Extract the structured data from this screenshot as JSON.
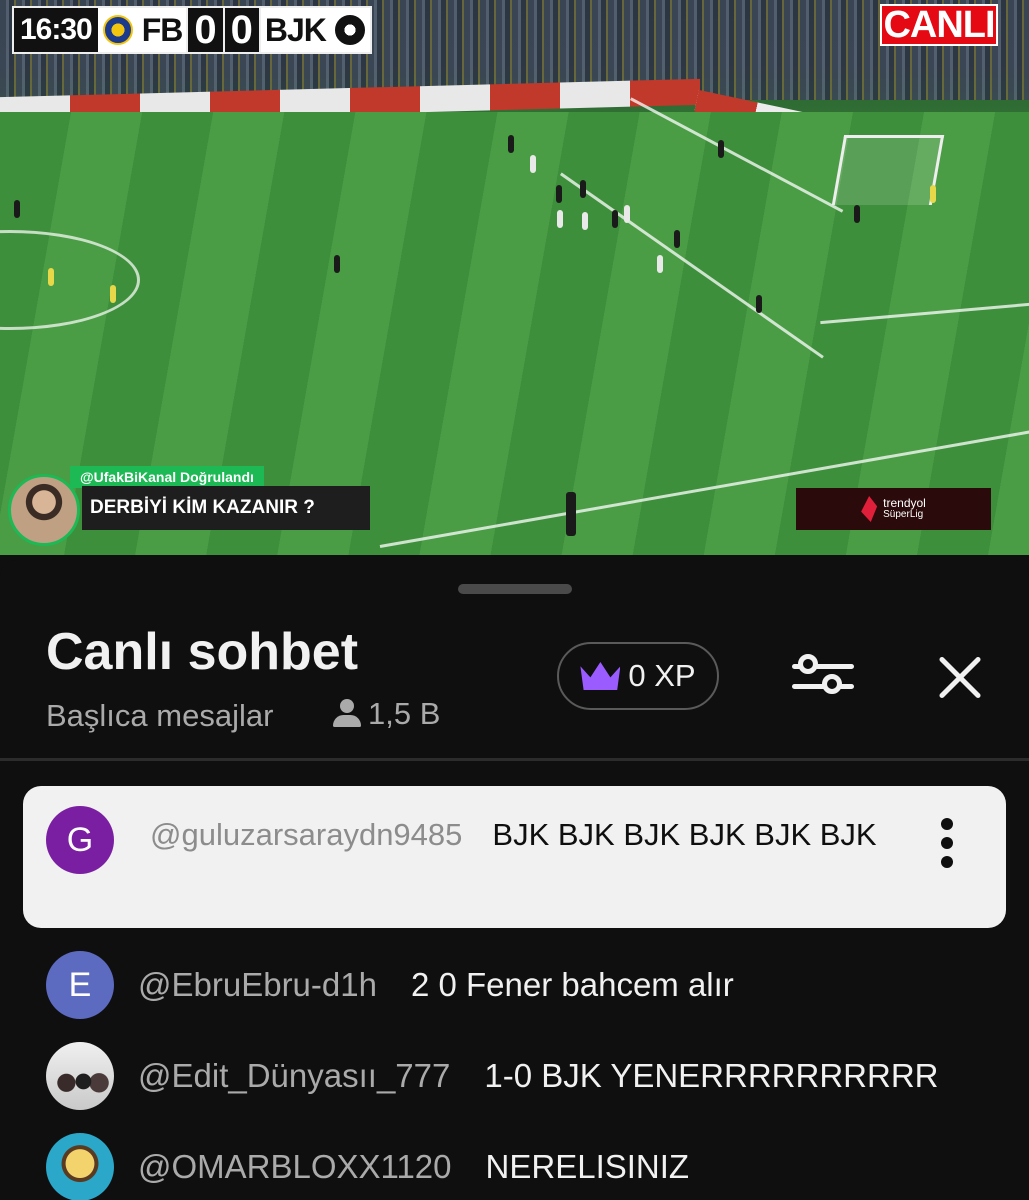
{
  "video": {
    "clock": "16:30",
    "home_team": "FB",
    "home_score": "0",
    "away_score": "0",
    "away_team": "BJK",
    "live_label": "CANLI",
    "streamer_tag": "@UfakBiKanal Doğrulandı",
    "question": "DERBİYİ KİM KAZANIR ?",
    "league_line1": "trendyol",
    "league_line2": "SüperLig"
  },
  "chat": {
    "title": "Canlı sohbet",
    "mode": "Başlıca mesajlar",
    "viewer_count": "1,5 B",
    "xp_label": "0 XP",
    "icons": {
      "viewers": "person-icon",
      "xp": "crown-icon",
      "filter": "sliders-icon",
      "close": "close-icon",
      "more": "kebab-menu-icon"
    },
    "colors": {
      "crown": "#9b5cff",
      "pinned_avatar": "#7b1fa2",
      "avatar_e": "#5c6bc0",
      "background": "#0f0f0f"
    },
    "pinned": {
      "avatar_letter": "G",
      "author": "@guluzarsaraydn9485",
      "text": "BJK BJK BJK BJK BJK BJK"
    },
    "messages": [
      {
        "avatar_letter": "E",
        "author": "@EbruEbru-d1h",
        "text": "2 0 Fener bahcem alır"
      },
      {
        "avatar_letter": "",
        "author": "@Edit_Dünyasıı_777",
        "text": "1-0 BJK YENERRRRRRRRRR"
      },
      {
        "avatar_letter": "",
        "author": "@OMARBLOXX1120",
        "text": "NERELISINIZ"
      }
    ]
  }
}
